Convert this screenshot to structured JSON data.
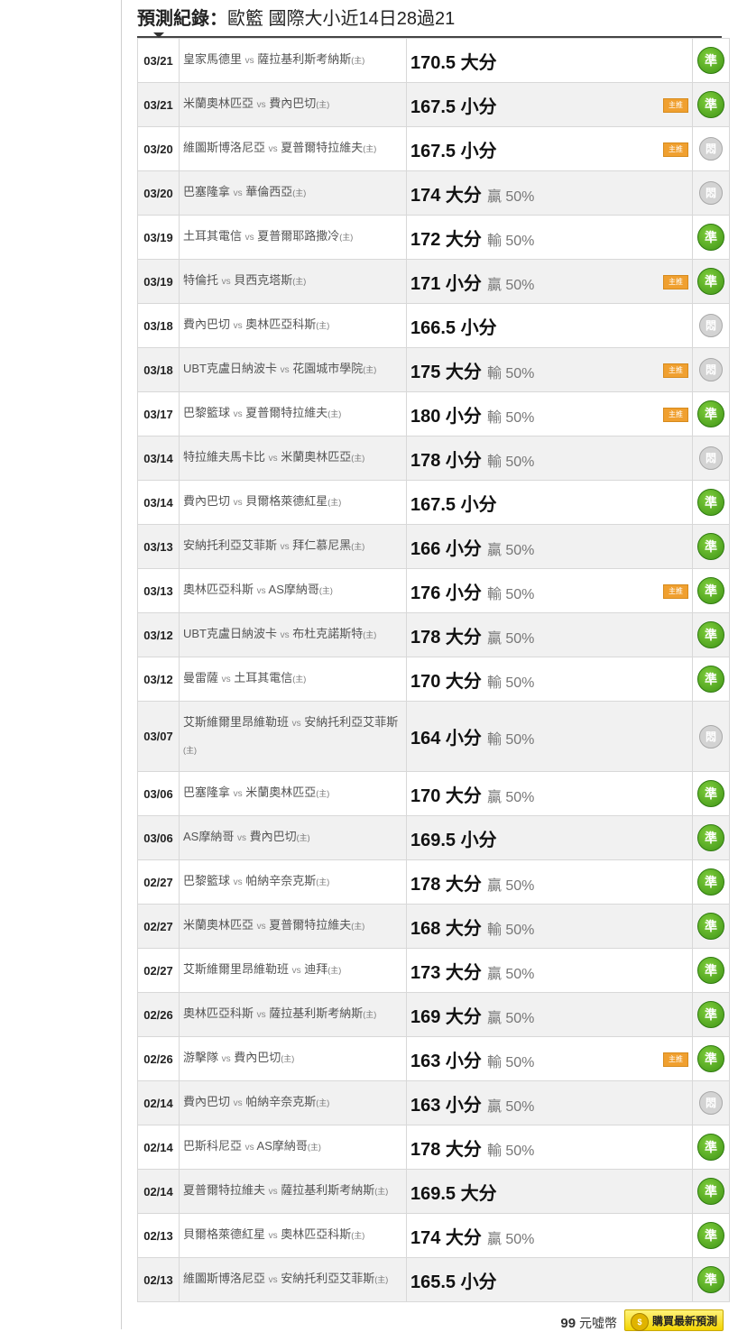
{
  "header": {
    "label": "預測紀錄：",
    "title": "歐籃 國際大小近14日28過21"
  },
  "labels": {
    "vs": "vs",
    "host_mark": "(主)",
    "tag": "主推",
    "result_hit": "準",
    "result_pending": "悶"
  },
  "colors": {
    "hit": "#4da11f",
    "pending": "#d3d3d3",
    "tag": "#f0a030"
  },
  "rows": [
    {
      "date": "03/21",
      "away": "皇家馬德里",
      "home": "薩拉基利斯考納斯",
      "line": "170.5 大分",
      "pct": "",
      "tag": false,
      "result": "hit"
    },
    {
      "date": "03/21",
      "away": "米蘭奧林匹亞",
      "home": "費內巴切",
      "line": "167.5 小分",
      "pct": "",
      "tag": true,
      "result": "hit"
    },
    {
      "date": "03/20",
      "away": "維圖斯博洛尼亞",
      "home": "夏普爾特拉維夫",
      "line": "167.5 小分",
      "pct": "",
      "tag": true,
      "result": "pending"
    },
    {
      "date": "03/20",
      "away": "巴塞隆拿",
      "home": "華倫西亞",
      "line": "174 大分",
      "pct": "贏 50%",
      "tag": false,
      "result": "pending"
    },
    {
      "date": "03/19",
      "away": "土耳其電信",
      "home": "夏普爾耶路撒冷",
      "line": "172 大分",
      "pct": "輸 50%",
      "tag": false,
      "result": "hit"
    },
    {
      "date": "03/19",
      "away": "特倫托",
      "home": "貝西克塔斯",
      "line": "171 小分",
      "pct": "贏 50%",
      "tag": true,
      "result": "hit"
    },
    {
      "date": "03/18",
      "away": "費內巴切",
      "home": "奧林匹亞科斯",
      "line": "166.5 小分",
      "pct": "",
      "tag": false,
      "result": "pending"
    },
    {
      "date": "03/18",
      "away": "UBT克盧日納波卡",
      "home": "花園城市學院",
      "line": "175 大分",
      "pct": "輸 50%",
      "tag": true,
      "result": "pending"
    },
    {
      "date": "03/17",
      "away": "巴黎籃球",
      "home": "夏普爾特拉維夫",
      "line": "180 小分",
      "pct": "輸 50%",
      "tag": true,
      "result": "hit"
    },
    {
      "date": "03/14",
      "away": "特拉維夫馬卡比",
      "home": "米蘭奧林匹亞",
      "line": "178 小分",
      "pct": "輸 50%",
      "tag": false,
      "result": "pending"
    },
    {
      "date": "03/14",
      "away": "費內巴切",
      "home": "貝爾格萊德紅星",
      "line": "167.5 小分",
      "pct": "",
      "tag": false,
      "result": "hit"
    },
    {
      "date": "03/13",
      "away": "安納托利亞艾菲斯",
      "home": "拜仁慕尼黑",
      "line": "166 小分",
      "pct": "贏 50%",
      "tag": false,
      "result": "hit"
    },
    {
      "date": "03/13",
      "away": "奧林匹亞科斯",
      "home": "AS摩納哥",
      "line": "176 小分",
      "pct": "輸 50%",
      "tag": true,
      "result": "hit"
    },
    {
      "date": "03/12",
      "away": "UBT克盧日納波卡",
      "home": "布杜克諾斯特",
      "line": "178 大分",
      "pct": "贏 50%",
      "tag": false,
      "result": "hit"
    },
    {
      "date": "03/12",
      "away": "曼雷薩",
      "home": "土耳其電信",
      "line": "170 大分",
      "pct": "輸 50%",
      "tag": false,
      "result": "hit"
    },
    {
      "date": "03/07",
      "away": "艾斯維爾里昂維勒班",
      "home": "安納托利亞艾菲斯",
      "line": "164 小分",
      "pct": "輸 50%",
      "tag": false,
      "result": "pending",
      "tall": true
    },
    {
      "date": "03/06",
      "away": "巴塞隆拿",
      "home": "米蘭奧林匹亞",
      "line": "170 大分",
      "pct": "贏 50%",
      "tag": false,
      "result": "hit"
    },
    {
      "date": "03/06",
      "away": "AS摩納哥",
      "home": "費內巴切",
      "line": "169.5 小分",
      "pct": "",
      "tag": false,
      "result": "hit"
    },
    {
      "date": "02/27",
      "away": "巴黎籃球",
      "home": "帕納辛奈克斯",
      "line": "178 大分",
      "pct": "贏 50%",
      "tag": false,
      "result": "hit"
    },
    {
      "date": "02/27",
      "away": "米蘭奧林匹亞",
      "home": "夏普爾特拉維夫",
      "line": "168 大分",
      "pct": "輸 50%",
      "tag": false,
      "result": "hit"
    },
    {
      "date": "02/27",
      "away": "艾斯維爾里昂維勒班",
      "home": "迪拜",
      "line": "173 大分",
      "pct": "贏 50%",
      "tag": false,
      "result": "hit"
    },
    {
      "date": "02/26",
      "away": "奧林匹亞科斯",
      "home": "薩拉基利斯考納斯",
      "line": "169 大分",
      "pct": "贏 50%",
      "tag": false,
      "result": "hit"
    },
    {
      "date": "02/26",
      "away": "游擊隊",
      "home": "費內巴切",
      "line": "163 小分",
      "pct": "輸 50%",
      "tag": true,
      "result": "hit"
    },
    {
      "date": "02/14",
      "away": "費內巴切",
      "home": "帕納辛奈克斯",
      "line": "163 小分",
      "pct": "贏 50%",
      "tag": false,
      "result": "pending"
    },
    {
      "date": "02/14",
      "away": "巴斯科尼亞",
      "home": "AS摩納哥",
      "line": "178 大分",
      "pct": "輸 50%",
      "tag": false,
      "result": "hit"
    },
    {
      "date": "02/14",
      "away": "夏普爾特拉維夫",
      "home": "薩拉基利斯考納斯",
      "line": "169.5 大分",
      "pct": "",
      "tag": false,
      "result": "hit"
    },
    {
      "date": "02/13",
      "away": "貝爾格萊德紅星",
      "home": "奧林匹亞科斯",
      "line": "174 大分",
      "pct": "贏 50%",
      "tag": false,
      "result": "hit"
    },
    {
      "date": "02/13",
      "away": "維圖斯博洛尼亞",
      "home": "安納托利亞艾菲斯",
      "line": "165.5 小分",
      "pct": "",
      "tag": false,
      "result": "hit"
    }
  ],
  "footer": {
    "price_num": "99",
    "price_unit": "元噓幣",
    "buy_label": "購買最新預測"
  }
}
